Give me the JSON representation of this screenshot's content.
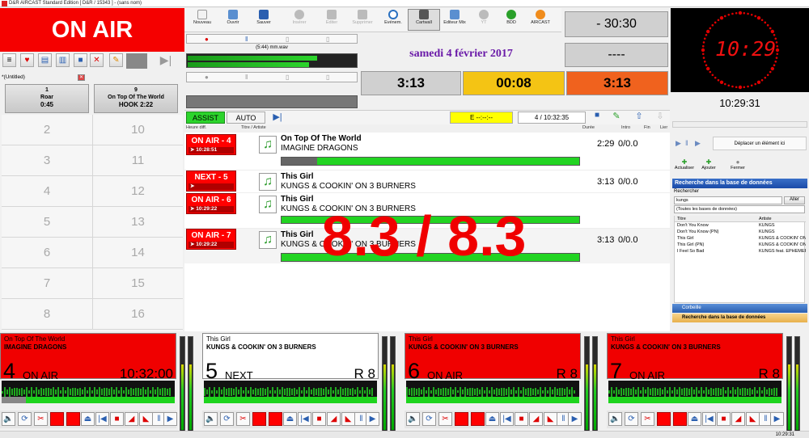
{
  "window": {
    "title": "D&R AIRCAST Standard Edition [ D&R / 15343 ] - (sans nom)"
  },
  "left": {
    "on_air_label": "ON AIR",
    "playlist_name": "*(Untitled)",
    "cart_slots": [
      {
        "number": "1",
        "title": "Roar",
        "time": "0:45"
      },
      {
        "number": "9",
        "title": "On Top Of The World",
        "time": "HOOK 2:22"
      }
    ],
    "empty_slots_left": [
      "2",
      "3",
      "4",
      "5",
      "6",
      "7",
      "8"
    ],
    "empty_slots_right": [
      "10",
      "11",
      "12",
      "13",
      "14",
      "15",
      "16"
    ]
  },
  "toolbar": {
    "items": [
      {
        "label": "Nouveau",
        "color": "#f2f2f2"
      },
      {
        "label": "Ouvrir",
        "color": "#5a8fd0"
      },
      {
        "label": "Sauver",
        "color": "#2a5fb0"
      },
      {
        "label": "Insérer",
        "color": "#bbbbbb"
      },
      {
        "label": "Editer",
        "color": "#bbbbbb"
      },
      {
        "label": "Supprimer",
        "color": "#bbbbbb"
      },
      {
        "label": "Evénem.",
        "color": "#2a70c0"
      },
      {
        "label": "Cartwall",
        "color": "#555555"
      },
      {
        "label": "Editeur Mix",
        "color": "#5a8fd0"
      },
      {
        "label": "YT",
        "color": "#bbbbbb"
      },
      {
        "label": "BDD",
        "color": "#2aa02a"
      },
      {
        "label": "AIRCAST",
        "color": "#f08c1c"
      }
    ],
    "recorder_file": "(5:44) mm.wav"
  },
  "center": {
    "date": "samedi 4 février 2017",
    "countdown": "- 30:30",
    "countdown2": "----",
    "timer_left": "3:13",
    "timer_mid": "00:08",
    "timer_right": "3:13",
    "mode_assist": "ASSIST",
    "mode_auto": "AUTO",
    "event_box": "E  --:--:--",
    "counter": "4 / 10:32:35",
    "col_heure": "Heure diff.",
    "col_titre": "Titre / Artiste",
    "col_duree": "Durée",
    "col_intro": "Intro",
    "col_fin": "Fin",
    "col_lier": "Lier"
  },
  "playlist": [
    {
      "tag": "ON AIR - 4",
      "time": "10:28:51",
      "title": "On Top Of The World",
      "artist": "IMAGINE DRAGONS",
      "duration": "2:29",
      "intro": "0/0.0"
    },
    {
      "tag": "NEXT - 5",
      "time": "",
      "title": "This Girl",
      "artist": "KUNGS & COOKIN' ON 3 BURNERS",
      "duration": "3:13",
      "intro": "0/0.0"
    },
    {
      "tag": "ON AIR - 6",
      "time": "10:29:22",
      "title": "This Girl",
      "artist": "KUNGS & COOKIN' ON 3 BURNERS",
      "duration": "",
      "intro": ""
    },
    {
      "tag": "ON AIR - 7",
      "time": "10:29:22",
      "title": "This Girl",
      "artist": "KUNGS & COOKIN' ON 3 BURNERS",
      "duration": "3:13",
      "intro": "0/0.0"
    }
  ],
  "overlay_text": "8.3 / 8.3",
  "clock": {
    "digital": "10:29",
    "time": "10:29:31"
  },
  "right_panel": {
    "move_label": "Déplacer un élément ici",
    "btn_refresh": "Actualiser",
    "btn_add": "Ajouter",
    "btn_close": "Fermer",
    "db_title": "Recherche dans la base de données",
    "search_label": "Rechercher",
    "search_value": "kungs",
    "search_button": "Aller",
    "db_filter": "(Toutes les bases de données)",
    "col_title": "Titre",
    "col_artist": "Artiste",
    "results": [
      {
        "title": "Don't You Know",
        "artist": "KUNGS"
      },
      {
        "title": "Don't You Know (PN)",
        "artist": "KUNGS"
      },
      {
        "title": "This Girl",
        "artist": "KUNGS & COOKIN' ON"
      },
      {
        "title": "This Girl (PN)",
        "artist": "KUNGS & COOKIN' ON"
      },
      {
        "title": "I Feel So Bad",
        "artist": "KUNGS feat. EPHEMER"
      }
    ],
    "tab_corbeille": "Corbeille",
    "tab_db": "Recherche dans la base de données"
  },
  "players": [
    {
      "title": "On Top Of The World",
      "artist": "IMAGINE DRAGONS",
      "number": "4",
      "state": "ON AIR",
      "right": "10:32:00",
      "bg": "#f00000",
      "fg": "#000"
    },
    {
      "title": "This Girl",
      "artist": "KUNGS & COOKIN' ON 3 BURNERS",
      "number": "5",
      "state": "NEXT",
      "right": "R 8",
      "bg": "#ffffff",
      "fg": "#000"
    },
    {
      "title": "This Girl",
      "artist": "KUNGS & COOKIN' ON 3 BURNERS",
      "number": "6",
      "state": "ON AIR",
      "right": "R 8",
      "bg": "#f00000",
      "fg": "#000"
    },
    {
      "title": "This Girl",
      "artist": "KUNGS & COOKIN' ON 3 BURNERS",
      "number": "7",
      "state": "ON AIR",
      "right": "R 8",
      "bg": "#f00000",
      "fg": "#000"
    }
  ],
  "status": {
    "time": "10:29:31"
  }
}
